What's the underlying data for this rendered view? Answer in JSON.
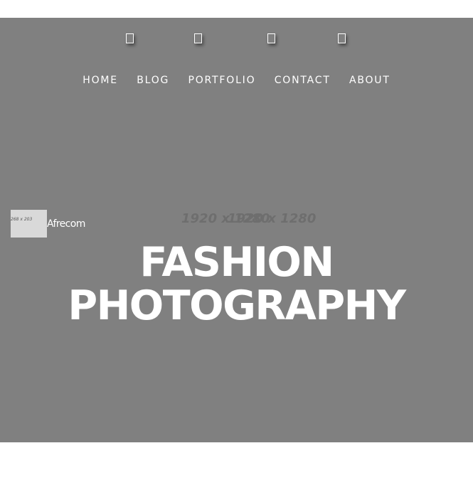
{
  "social": {
    "icons": [
      "facebook-icon",
      "twitter-icon",
      "instagram-icon",
      "pinterest-icon"
    ]
  },
  "nav": {
    "items": [
      "HOME",
      "BLOG",
      "PORTFOLIO",
      "CONTACT",
      "ABOUT"
    ]
  },
  "hero": {
    "background_placeholder": "1920 x 1280",
    "background_placeholder_2": "1920 x 1280",
    "title_line1": "FASHION",
    "title_line2": "PHOTOGRAPHY",
    "background_color": "#808080"
  },
  "logo": {
    "image_placeholder": "268 x 203",
    "text": "Afrecom"
  }
}
